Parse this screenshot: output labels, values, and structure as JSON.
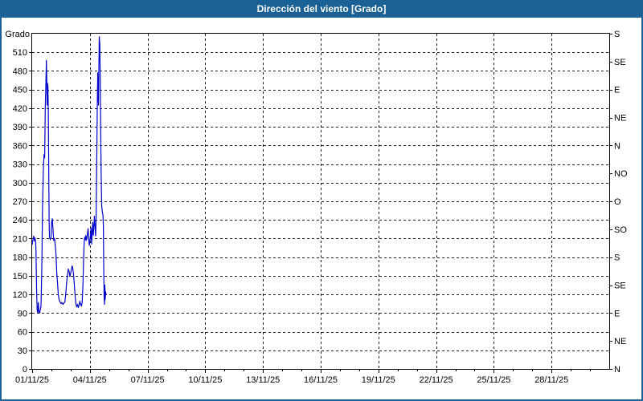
{
  "window": {
    "title": "Dirección del viento [Grado]",
    "colors": {
      "titlebar": "#1a6296",
      "frame_border": "#1a6296",
      "title_text": "#ffffff",
      "plot_border": "#000000",
      "grid": "#1a1a1a",
      "axis_text": "#000000",
      "line": "#0000cc",
      "background": "#ffffff"
    }
  },
  "chart_data": {
    "type": "line",
    "title": "Dirección del viento [Grado]",
    "y_axis_left_title": "Grado",
    "ylim": [
      0,
      540
    ],
    "y_left_tick_step": 30,
    "y_left_ticks": [
      0,
      30,
      60,
      90,
      120,
      150,
      180,
      210,
      240,
      270,
      300,
      330,
      360,
      390,
      420,
      450,
      480,
      510
    ],
    "y_right_ticks": [
      {
        "value": 0,
        "label": "N"
      },
      {
        "value": 45,
        "label": "NE"
      },
      {
        "value": 90,
        "label": "E"
      },
      {
        "value": 135,
        "label": "SE"
      },
      {
        "value": 180,
        "label": "S"
      },
      {
        "value": 225,
        "label": "SO"
      },
      {
        "value": 270,
        "label": "O"
      },
      {
        "value": 315,
        "label": "NO"
      },
      {
        "value": 360,
        "label": "N"
      },
      {
        "value": 405,
        "label": "NE"
      },
      {
        "value": 450,
        "label": "E"
      },
      {
        "value": 495,
        "label": "SE"
      },
      {
        "value": 540,
        "label": "S"
      }
    ],
    "xlim_days": [
      0,
      30
    ],
    "x_minor_step_days": 1,
    "x_ticks": [
      {
        "day": 0,
        "label": "01/11/25"
      },
      {
        "day": 3,
        "label": "04/11/25"
      },
      {
        "day": 6,
        "label": "07/11/25"
      },
      {
        "day": 9,
        "label": "10/11/25"
      },
      {
        "day": 12,
        "label": "13/11/25"
      },
      {
        "day": 15,
        "label": "16/11/25"
      },
      {
        "day": 18,
        "label": "19/11/25"
      },
      {
        "day": 21,
        "label": "22/11/25"
      },
      {
        "day": 24,
        "label": "25/11/25"
      },
      {
        "day": 27,
        "label": "28/11/25"
      }
    ],
    "grid": "dashed",
    "legend": "none",
    "series": [
      {
        "name": "Dirección del viento",
        "unit": "Grado",
        "color": "#0000cc",
        "points": [
          [
            0.0,
            200
          ],
          [
            0.04,
            208
          ],
          [
            0.08,
            214
          ],
          [
            0.12,
            206
          ],
          [
            0.15,
            211
          ],
          [
            0.18,
            204
          ],
          [
            0.2,
            190
          ],
          [
            0.23,
            130
          ],
          [
            0.26,
            96
          ],
          [
            0.29,
            90
          ],
          [
            0.32,
            107
          ],
          [
            0.35,
            92
          ],
          [
            0.39,
            90
          ],
          [
            0.43,
            96
          ],
          [
            0.46,
            102
          ],
          [
            0.5,
            160
          ],
          [
            0.54,
            260
          ],
          [
            0.58,
            320
          ],
          [
            0.62,
            345
          ],
          [
            0.65,
            340
          ],
          [
            0.68,
            420
          ],
          [
            0.71,
            455
          ],
          [
            0.74,
            497
          ],
          [
            0.76,
            465
          ],
          [
            0.78,
            425
          ],
          [
            0.8,
            460
          ],
          [
            0.82,
            455
          ],
          [
            0.84,
            415
          ],
          [
            0.86,
            330
          ],
          [
            0.88,
            240
          ],
          [
            0.9,
            213
          ],
          [
            0.94,
            208
          ],
          [
            0.98,
            212
          ],
          [
            1.02,
            238
          ],
          [
            1.05,
            242
          ],
          [
            1.08,
            228
          ],
          [
            1.12,
            207
          ],
          [
            1.16,
            210
          ],
          [
            1.2,
            200
          ],
          [
            1.24,
            184
          ],
          [
            1.28,
            155
          ],
          [
            1.32,
            138
          ],
          [
            1.36,
            120
          ],
          [
            1.4,
            112
          ],
          [
            1.45,
            108
          ],
          [
            1.5,
            105
          ],
          [
            1.55,
            107
          ],
          [
            1.6,
            104
          ],
          [
            1.65,
            106
          ],
          [
            1.7,
            108
          ],
          [
            1.74,
            118
          ],
          [
            1.79,
            138
          ],
          [
            1.84,
            152
          ],
          [
            1.88,
            161
          ],
          [
            1.92,
            157
          ],
          [
            1.96,
            149
          ],
          [
            2.0,
            154
          ],
          [
            2.04,
            160
          ],
          [
            2.08,
            166
          ],
          [
            2.12,
            161
          ],
          [
            2.16,
            149
          ],
          [
            2.2,
            132
          ],
          [
            2.24,
            115
          ],
          [
            2.28,
            104
          ],
          [
            2.32,
            100
          ],
          [
            2.36,
            104
          ],
          [
            2.4,
            99
          ],
          [
            2.44,
            103
          ],
          [
            2.48,
            109
          ],
          [
            2.52,
            104
          ],
          [
            2.56,
            101
          ],
          [
            2.6,
            107
          ],
          [
            2.64,
            135
          ],
          [
            2.67,
            172
          ],
          [
            2.7,
            200
          ],
          [
            2.73,
            212
          ],
          [
            2.76,
            208
          ],
          [
            2.79,
            215
          ],
          [
            2.82,
            207
          ],
          [
            2.85,
            212
          ],
          [
            2.88,
            219
          ],
          [
            2.91,
            226
          ],
          [
            2.94,
            211
          ],
          [
            2.97,
            199
          ],
          [
            3.0,
            205
          ],
          [
            3.03,
            215
          ],
          [
            3.06,
            227
          ],
          [
            3.09,
            201
          ],
          [
            3.12,
            222
          ],
          [
            3.15,
            236
          ],
          [
            3.18,
            215
          ],
          [
            3.21,
            230
          ],
          [
            3.24,
            246
          ],
          [
            3.27,
            228
          ],
          [
            3.3,
            214
          ],
          [
            3.33,
            250
          ],
          [
            3.36,
            340
          ],
          [
            3.39,
            430
          ],
          [
            3.41,
            477
          ],
          [
            3.43,
            440
          ],
          [
            3.45,
            425
          ],
          [
            3.47,
            480
          ],
          [
            3.49,
            535
          ],
          [
            3.52,
            522
          ],
          [
            3.54,
            470
          ],
          [
            3.56,
            400
          ],
          [
            3.58,
            330
          ],
          [
            3.6,
            285
          ],
          [
            3.62,
            262
          ],
          [
            3.65,
            252
          ],
          [
            3.68,
            248
          ],
          [
            3.7,
            230
          ],
          [
            3.72,
            170
          ],
          [
            3.74,
            118
          ],
          [
            3.76,
            104
          ],
          [
            3.78,
            135
          ],
          [
            3.8,
            112
          ],
          [
            3.82,
            124
          ],
          [
            3.84,
            120
          ]
        ]
      }
    ]
  }
}
